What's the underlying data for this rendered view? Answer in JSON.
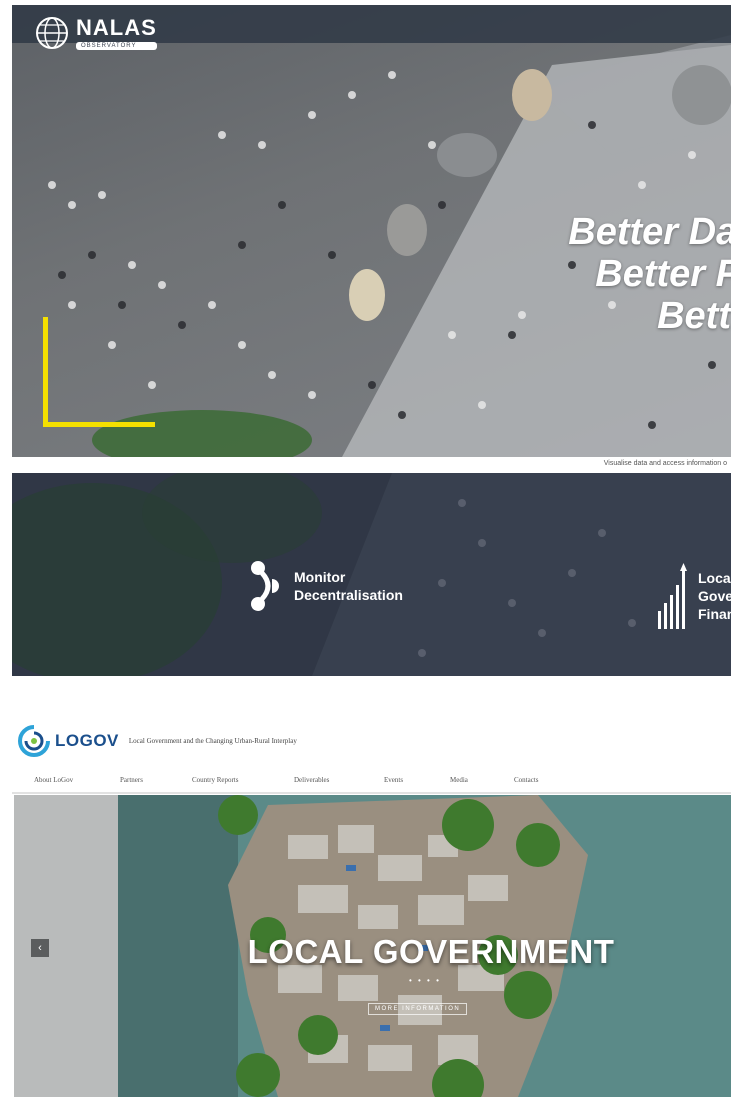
{
  "nalas": {
    "logo": {
      "name": "NALAS",
      "tagline": "OBSERVATORY"
    },
    "hero": {
      "lines": [
        "Better Data",
        "Better P",
        "Bett"
      ]
    },
    "strip_text": "Visualise data and access information o",
    "features": [
      {
        "label_1": "Monitor",
        "label_2": "Decentralisation"
      },
      {
        "label_1": "Loca",
        "label_2": "Gove",
        "label_3": "Finan"
      }
    ],
    "colors": {
      "accent_yellow": "#f5e000",
      "band": "#303746"
    }
  },
  "logov": {
    "logo": "LOGOV",
    "tagline": "Local Government and the Changing Urban-Rural Interplay",
    "nav": [
      "About LoGov",
      "Partners",
      "Country Reports",
      "Deliverables",
      "Events",
      "Media",
      "Contacts"
    ],
    "slider": {
      "prev_icon": "chevron-left-icon",
      "prev_label": "‹",
      "title": "LOCAL GOVERNMENT",
      "dots": "• • • •",
      "more": "MORE INFORMATION"
    },
    "colors": {
      "brand": "#1b4f8c"
    }
  }
}
